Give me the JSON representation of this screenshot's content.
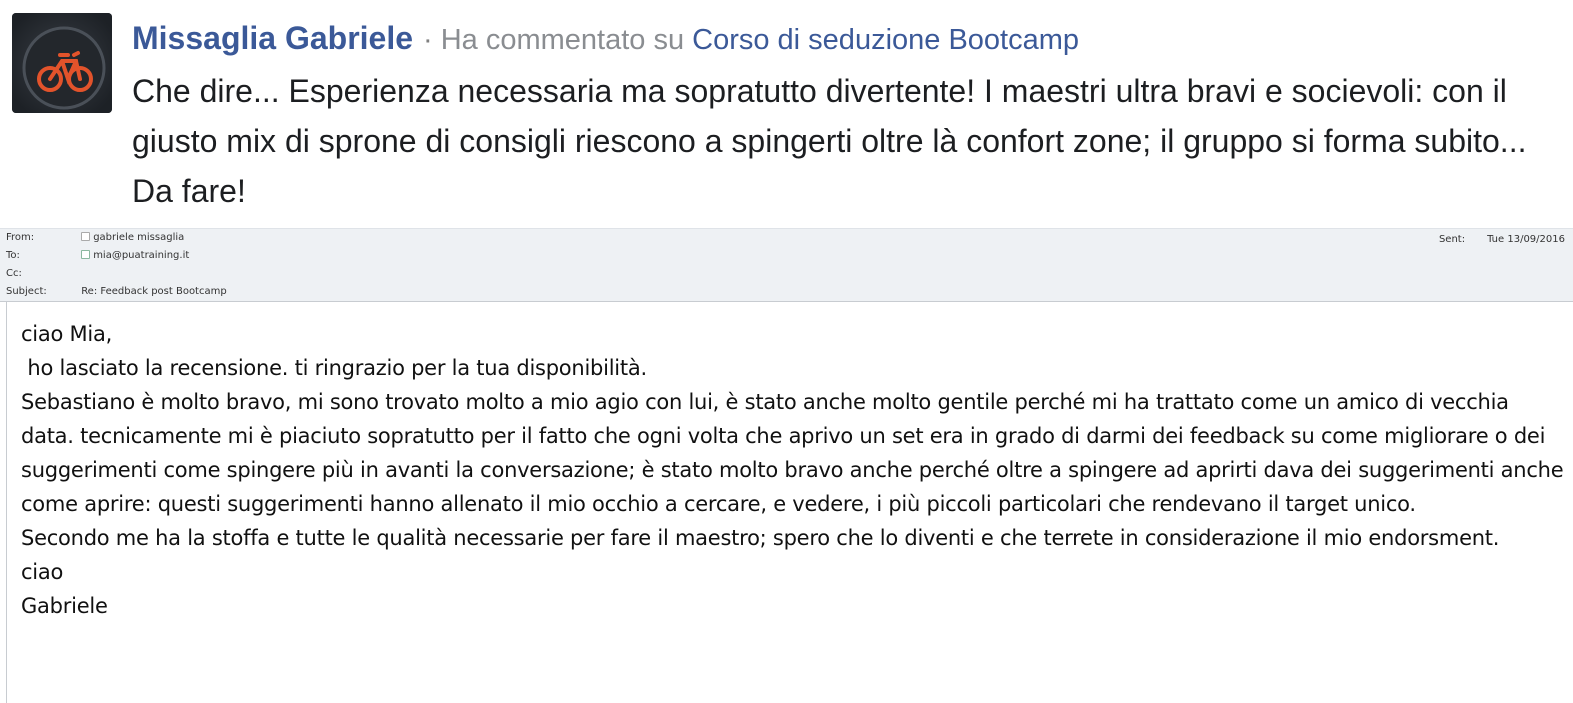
{
  "review": {
    "author": "Missaglia Gabriele",
    "separator": "·",
    "action": "Ha commentato su",
    "course": "Corso di seduzione Bootcamp",
    "text": "Che dire... Esperienza necessaria ma sopratutto divertente! I maestri ultra bravi e socievoli: con il giusto mix di sprone di consigli riescono a spingerti oltre là confort zone; il gruppo si forma subito... Da fare!",
    "avatar_icon": "bicycle-avatar"
  },
  "email": {
    "from_label": "From:",
    "from_value": "gabriele missaglia",
    "to_label": "To:",
    "to_value": "mia@puatraining.it",
    "cc_label": "Cc:",
    "cc_value": "",
    "subject_label": "Subject:",
    "subject_value": "Re: Feedback post Bootcamp",
    "sent_label": "Sent:",
    "sent_value": "Tue 13/09/2016",
    "body": [
      "ciao Mia,",
      " ho lasciato la recensione. ti ringrazio per la tua disponibilità.",
      "Sebastiano è molto bravo, mi sono trovato molto a mio agio con lui, è stato anche molto gentile perché mi ha trattato come un amico di vecchia data. tecnicamente mi è piaciuto sopratutto per il fatto che ogni volta che aprivo un set era in grado di darmi dei feedback su come migliorare o dei suggerimenti come spingere più in avanti la conversazione; è stato molto bravo anche perché oltre a spingere ad aprirti dava dei suggerimenti anche come aprire: questi suggerimenti hanno allenato il mio occhio a cercare, e vedere, i più piccoli particolari che rendevano il target unico.",
      "Secondo me ha la stoffa e tutte le qualità necessarie per fare il maestro; spero che lo diventi e che terrete in considerazione il mio endorsment.",
      "ciao",
      "Gabriele"
    ]
  },
  "colors": {
    "link": "#3b5998",
    "muted": "#8a8d91",
    "header_bg": "#eef1f4"
  }
}
